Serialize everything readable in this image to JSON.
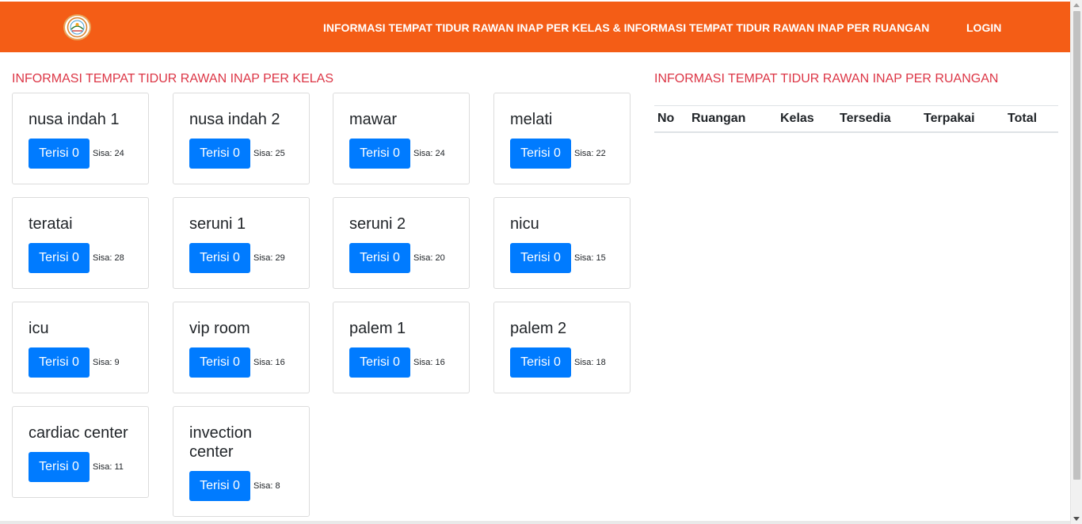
{
  "navbar": {
    "brand_color": "#f45d16",
    "logo_icon": "hospital-logo-icon",
    "main_link": "INFORMASI TEMPAT TIDUR RAWAN INAP PER KELAS & INFORMASI TEMPAT TIDUR RAWAN INAP PER RUANGAN",
    "login_link": "LOGIN"
  },
  "left": {
    "title": "INFORMASI TEMPAT TIDUR RAWAN INAP PER KELAS",
    "cards": [
      {
        "name": "nusa indah 1",
        "terisi": "Terisi 0",
        "sisa": "Sisa: 24"
      },
      {
        "name": "nusa indah 2",
        "terisi": "Terisi 0",
        "sisa": "Sisa: 25"
      },
      {
        "name": "mawar",
        "terisi": "Terisi 0",
        "sisa": "Sisa: 24"
      },
      {
        "name": "melati",
        "terisi": "Terisi 0",
        "sisa": "Sisa: 22"
      },
      {
        "name": "teratai",
        "terisi": "Terisi 0",
        "sisa": "Sisa: 28"
      },
      {
        "name": "seruni 1",
        "terisi": "Terisi 0",
        "sisa": "Sisa: 29"
      },
      {
        "name": "seruni 2",
        "terisi": "Terisi 0",
        "sisa": "Sisa: 20"
      },
      {
        "name": "nicu",
        "terisi": "Terisi 0",
        "sisa": "Sisa: 15"
      },
      {
        "name": "icu",
        "terisi": "Terisi 0",
        "sisa": "Sisa: 9"
      },
      {
        "name": "vip room",
        "terisi": "Terisi 0",
        "sisa": "Sisa: 16"
      },
      {
        "name": "palem 1",
        "terisi": "Terisi 0",
        "sisa": "Sisa: 16"
      },
      {
        "name": "palem 2",
        "terisi": "Terisi 0",
        "sisa": "Sisa: 18"
      },
      {
        "name": "cardiac center",
        "terisi": "Terisi 0",
        "sisa": "Sisa: 11"
      },
      {
        "name": "invection center",
        "terisi": "Terisi 0",
        "sisa": "Sisa: 8"
      }
    ]
  },
  "right": {
    "title": "INFORMASI TEMPAT TIDUR RAWAN INAP PER RUANGAN",
    "table_headers": [
      "No",
      "Ruangan",
      "Kelas",
      "Tersedia",
      "Terpakai",
      "Total"
    ]
  },
  "colors": {
    "title_red": "#dc3545",
    "button_blue": "#007bff"
  }
}
